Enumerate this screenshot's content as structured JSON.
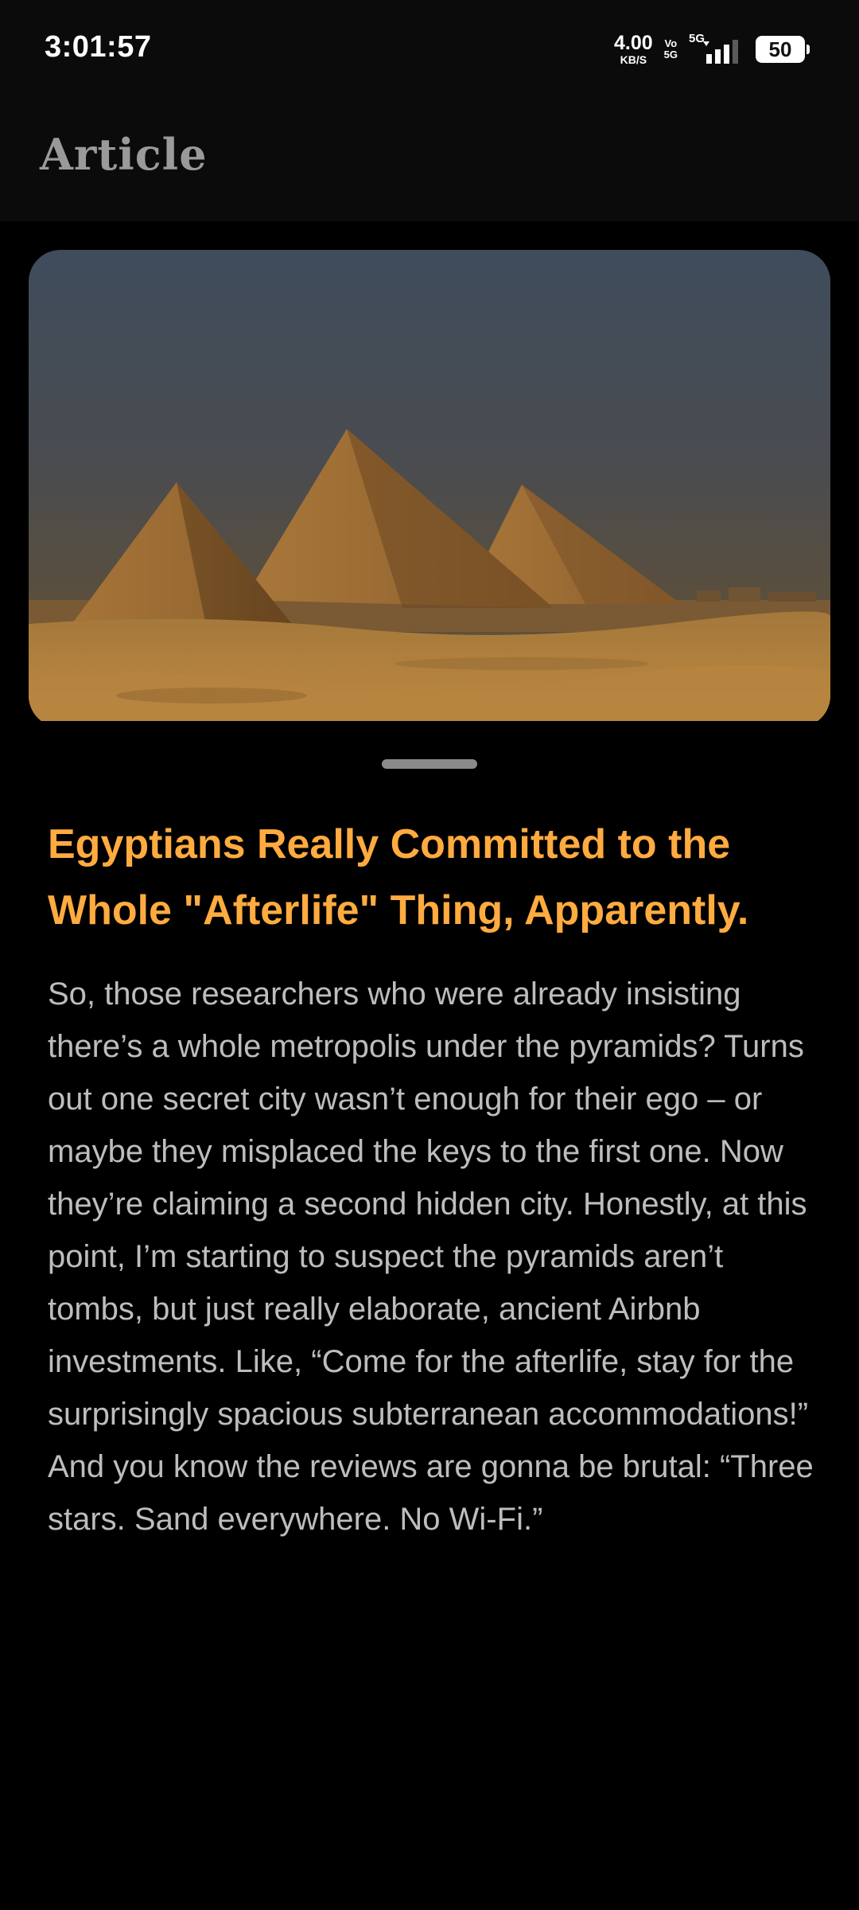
{
  "status_bar": {
    "time": "3:01:57",
    "net_speed_value": "4.00",
    "net_speed_unit": "KB/S",
    "volte_top": "Vo",
    "volte_bottom": "5G",
    "network_type": "5G",
    "battery_level": "50",
    "icons": [
      "wifi-speed",
      "volte-icon",
      "signal-icon",
      "battery-icon"
    ]
  },
  "app_bar": {
    "title": "Article"
  },
  "hero_image": {
    "subject": "pyramids-at-dusk",
    "sky_top": "#3f4c5c",
    "sand": "#c08a40"
  },
  "article": {
    "title": "Egyptians Really Committed to the Whole \"Afterlife\" Thing, Apparently.",
    "body": "So, those researchers who were already insisting there’s a whole metropolis under the pyramids? Turns out one secret city wasn’t enough for their ego – or maybe they misplaced the keys to the first one. Now they’re claiming a second hidden city. Honestly, at this point, I’m starting to suspect the pyramids aren’t tombs, but just really elaborate, ancient Airbnb investments. Like, “Come for the afterlife, stay for the surprisingly spacious subterranean accommodations!” And you know the reviews are gonna be brutal: “Three stars. Sand everywhere. No Wi-Fi.”"
  },
  "colors": {
    "background": "#000000",
    "app_bar": "#0b0b0c",
    "accent_title": "#ffab40",
    "body_text": "#bdbdbd",
    "handle": "#8a8a8a"
  }
}
